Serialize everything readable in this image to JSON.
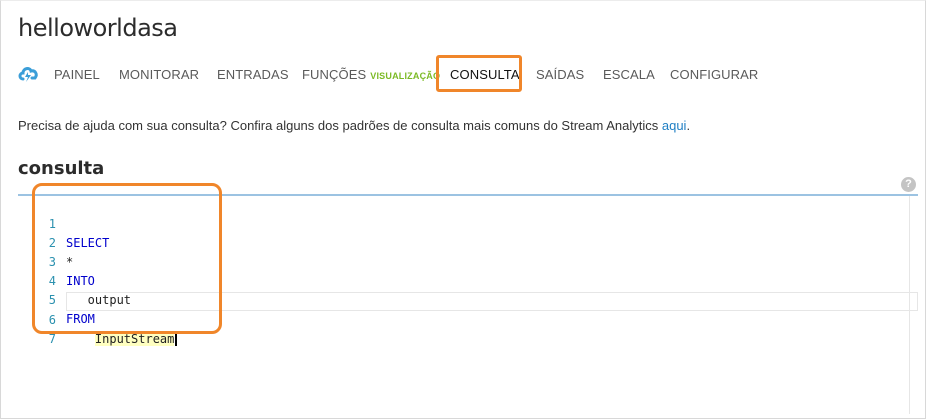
{
  "app": {
    "title": "helloworldasa"
  },
  "nav": {
    "icon": "cloud-lightning-icon",
    "tabs": [
      {
        "label": "PAINEL"
      },
      {
        "label": "MONITORAR"
      },
      {
        "label": "ENTRADAS"
      },
      {
        "label": "FUNÇÕES",
        "badge": "VISUALIZAÇÃO"
      },
      {
        "label": "CONSULTA",
        "active": true
      },
      {
        "label": "SAÍDAS"
      },
      {
        "label": "ESCALA"
      },
      {
        "label": "CONFIGURAR"
      }
    ]
  },
  "help": {
    "text": "Precisa de ajuda com sua consulta? Confira alguns dos padrões de consulta mais comuns do Stream Analytics ",
    "link": "aqui",
    "trail": "."
  },
  "query": {
    "section_title": "consulta",
    "help_icon": "?",
    "lines": [
      {
        "n": "1",
        "text": "SELECT"
      },
      {
        "n": "2",
        "text": "*"
      },
      {
        "n": "3",
        "text": "INTO"
      },
      {
        "n": "4",
        "text": "   output"
      },
      {
        "n": "5",
        "text": "FROM"
      },
      {
        "n": "6",
        "indent": "    ",
        "text": "InputStream"
      },
      {
        "n": "7",
        "text": ""
      }
    ]
  },
  "colors": {
    "accent_highlight": "#f0862a",
    "badge": "#7cba25",
    "link": "#1f7fc4",
    "keyword": "#0000cc"
  }
}
